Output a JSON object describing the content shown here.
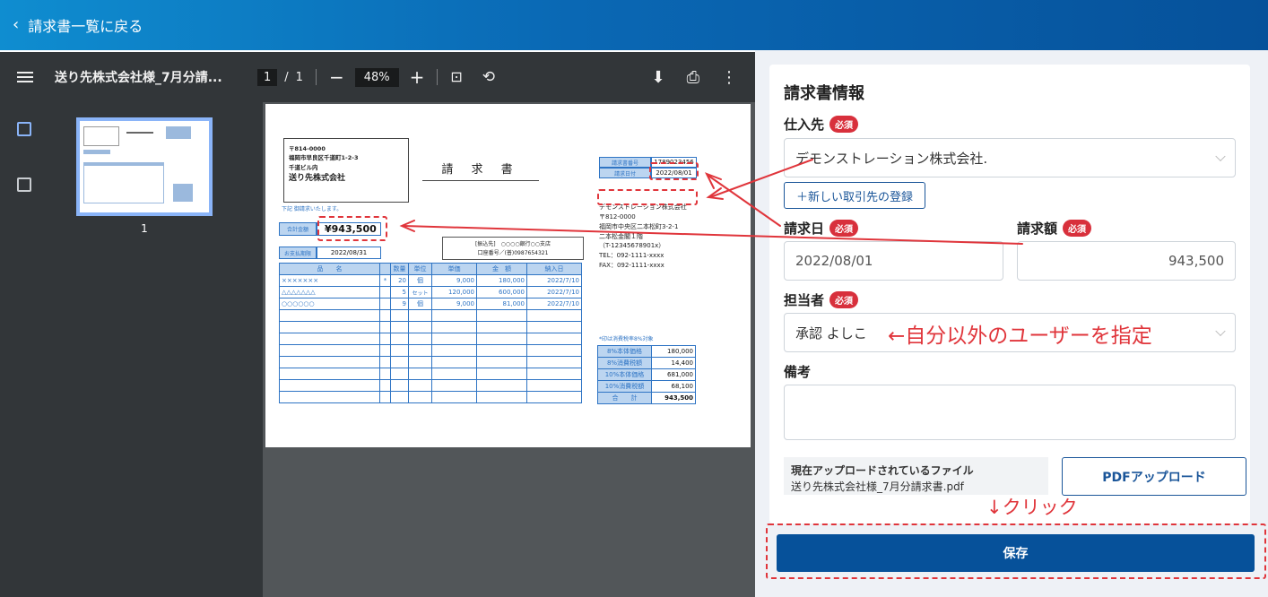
{
  "header": {
    "back_label": "請求書一覧に戻る"
  },
  "viewer": {
    "file_name": "送り先株式会社様_7月分請...",
    "page_current": "1",
    "page_sep": "/",
    "page_total": "1",
    "zoom": "48%",
    "thumbnail_label": "1"
  },
  "doc": {
    "postal": "〒814-0000",
    "address1": "福岡市早良区千道町1-2-3",
    "address2": "千道ビル内",
    "recipient": "送り先株式会社",
    "title": "請 求 書",
    "note": "下記 御請求いたします。",
    "invoice_no_label": "請求書番号",
    "invoice_no": "1789023456",
    "invoice_date_label": "請求日付",
    "invoice_date": "2022/08/01",
    "sender_name": "デモンストレーション株式会社",
    "sender_postal": "〒812-0000",
    "sender_addr1": "福岡市中央区二本松町3-2-1",
    "sender_addr2": "二本松金閣１階",
    "sender_reg": "（T-12345678901x）",
    "sender_tel": "TEL：092-1111-xxxx",
    "sender_fax": "FAX：092-1111-xxxx",
    "total_label": "合計金額",
    "total": "¥943,500",
    "due_label": "お支払期限",
    "due": "2022/08/31",
    "bank1": "[振込先]　○○○○銀行○○支店",
    "bank2": "口座番号／(普)0987654321",
    "columns": [
      "品　　名",
      "",
      "数量",
      "単位",
      "単価",
      "金　額",
      "納入日"
    ],
    "rows": [
      [
        "×××××××",
        "*",
        "20",
        "個",
        "9,000",
        "180,000",
        "2022/7/10"
      ],
      [
        "△△△△△△△",
        "",
        "5",
        "セット",
        "120,000",
        "600,000",
        "2022/7/10"
      ],
      [
        "○○○○○○",
        "",
        "9",
        "個",
        "9,000",
        "81,000",
        "2022/7/10"
      ]
    ],
    "tax_note": "*印は消費税率8%対象",
    "tax_rows": [
      [
        "8%本体価格",
        "180,000"
      ],
      [
        "8%消費税額",
        "14,400"
      ],
      [
        "10%本体価格",
        "681,000"
      ],
      [
        "10%消費税額",
        "68,100"
      ],
      [
        "合　　計",
        "943,500"
      ]
    ]
  },
  "form": {
    "heading": "請求書情報",
    "supplier_label": "仕入先",
    "required": "必須",
    "supplier_value": "デモンストレーション株式会社.",
    "new_partner_button": "＋新しい取引先の登録",
    "date_label": "請求日",
    "date_value": "2022/08/01",
    "amount_label": "請求額",
    "amount_value": "943,500",
    "person_label": "担当者",
    "person_value": "承認 よしこ",
    "memo_label": "備考",
    "memo_value": "",
    "file_title": "現在アップロードされているファイル",
    "file_name": "送り先株式会社様_7月分請求書.pdf",
    "upload_button": "PDFアップロード",
    "save_button": "保存"
  },
  "annotations": {
    "person_hint": "←自分以外のユーザーを指定",
    "click_hint": "↓クリック"
  }
}
